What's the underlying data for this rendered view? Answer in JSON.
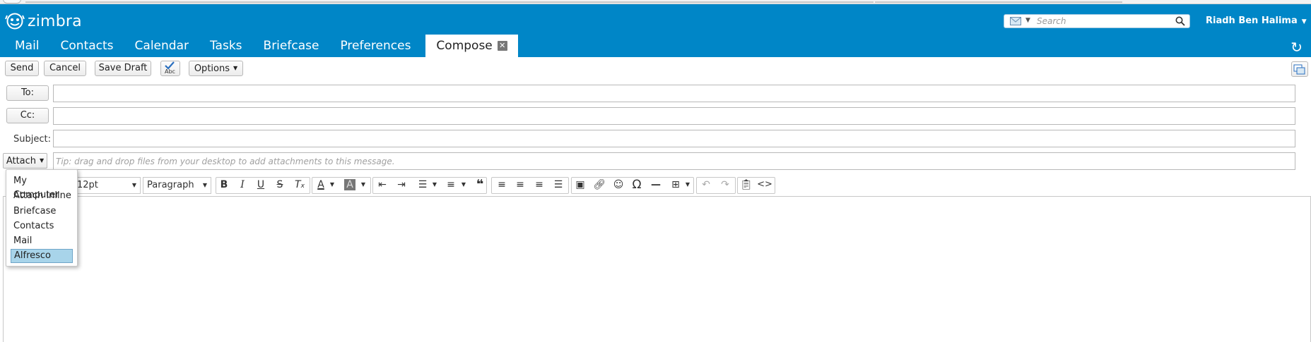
{
  "app": {
    "logo_text": "zimbra",
    "user_name": "Riadh Ben Halima"
  },
  "search": {
    "placeholder": "Search"
  },
  "tabs": [
    {
      "label": "Mail"
    },
    {
      "label": "Contacts"
    },
    {
      "label": "Calendar"
    },
    {
      "label": "Tasks"
    },
    {
      "label": "Briefcase"
    },
    {
      "label": "Preferences"
    },
    {
      "label": "Compose",
      "active": true
    }
  ],
  "toolbar": {
    "send": "Send",
    "cancel": "Cancel",
    "save_draft": "Save Draft",
    "spell_check_text": "Abc",
    "options": "Options"
  },
  "compose": {
    "to_label": "To:",
    "cc_label": "Cc:",
    "subject_label": "Subject:",
    "attach_label": "Attach",
    "tip": "Tip: drag and drop files from your desktop to add attachments to this message.",
    "to_value": "",
    "cc_value": "",
    "subject_value": ""
  },
  "editor": {
    "font_size": "12pt",
    "block_format": "Paragraph"
  },
  "attach_menu": [
    {
      "label": "My Computer"
    },
    {
      "label": "Attach Inline"
    },
    {
      "label": "Briefcase"
    },
    {
      "label": "Contacts"
    },
    {
      "label": "Mail"
    },
    {
      "label": "Alfresco",
      "highlighted": true
    }
  ],
  "colors": {
    "header_bg": "#0086c7",
    "menu_highlight": "#a8d4ea"
  }
}
